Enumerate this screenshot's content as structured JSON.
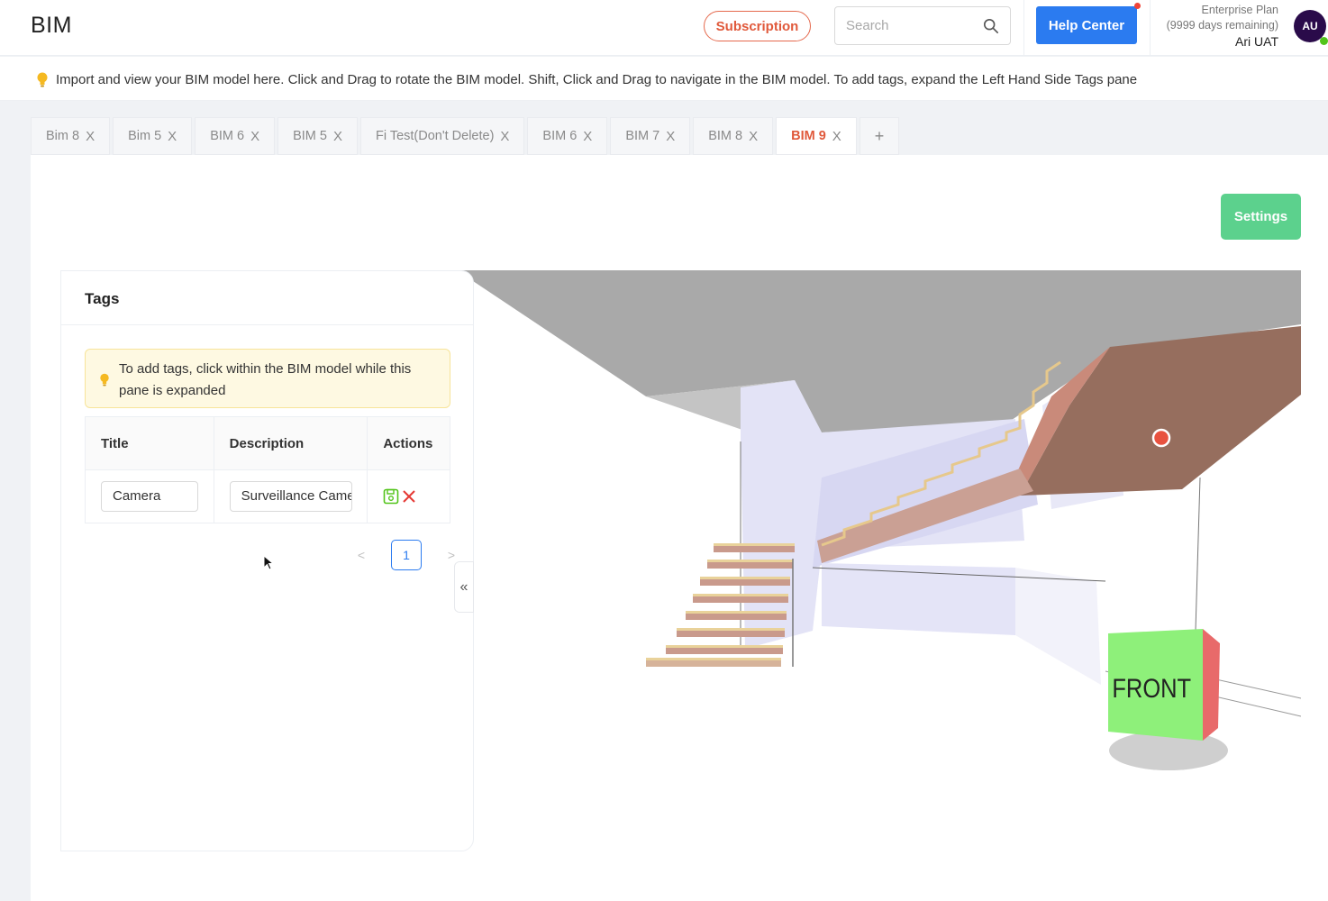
{
  "header": {
    "app_title": "BIM",
    "subscription_label": "Subscription",
    "search_placeholder": "Search",
    "help_label": "Help Center",
    "plan_name": "Enterprise Plan",
    "plan_remaining": "(9999 days remaining)",
    "user_name": "Ari UAT",
    "avatar_initials": "AU"
  },
  "info_bar": {
    "text": "Import and view your BIM model here. Click and Drag to rotate the BIM model. Shift, Click and Drag to navigate in the BIM model. To add tags, expand the Left Hand Side Tags pane"
  },
  "tabs": [
    {
      "label": "Bim 8",
      "active": false
    },
    {
      "label": "Bim 5",
      "active": false
    },
    {
      "label": "BIM 6",
      "active": false
    },
    {
      "label": "BIM 5",
      "active": false
    },
    {
      "label": "Fi Test(Don't Delete)",
      "active": false
    },
    {
      "label": "BIM 6",
      "active": false
    },
    {
      "label": "BIM 7",
      "active": false
    },
    {
      "label": "BIM 8",
      "active": false
    },
    {
      "label": "BIM 9",
      "active": true
    }
  ],
  "tab_close_glyph": "X",
  "tab_add_glyph": "+",
  "settings_label": "Settings",
  "tags_pane": {
    "title": "Tags",
    "notice": "To add tags, click within the BIM model while this pane is expanded",
    "columns": [
      "Title",
      "Description",
      "Actions"
    ],
    "rows": [
      {
        "title": "Camera",
        "description": "Surveillance Camera"
      }
    ],
    "pagination": {
      "current_page": "1",
      "prev": "<",
      "next": ">"
    },
    "collapse_glyph": "«"
  },
  "viewer": {
    "nav_cube_label": "FRONT"
  },
  "colors": {
    "accent_orange": "#e0593b",
    "primary_blue": "#2b7bf0",
    "settings_green": "#5cd18d",
    "tag_marker": "#e8523f",
    "cube_front": "#8ef07a",
    "cube_side": "#e86a6a"
  }
}
